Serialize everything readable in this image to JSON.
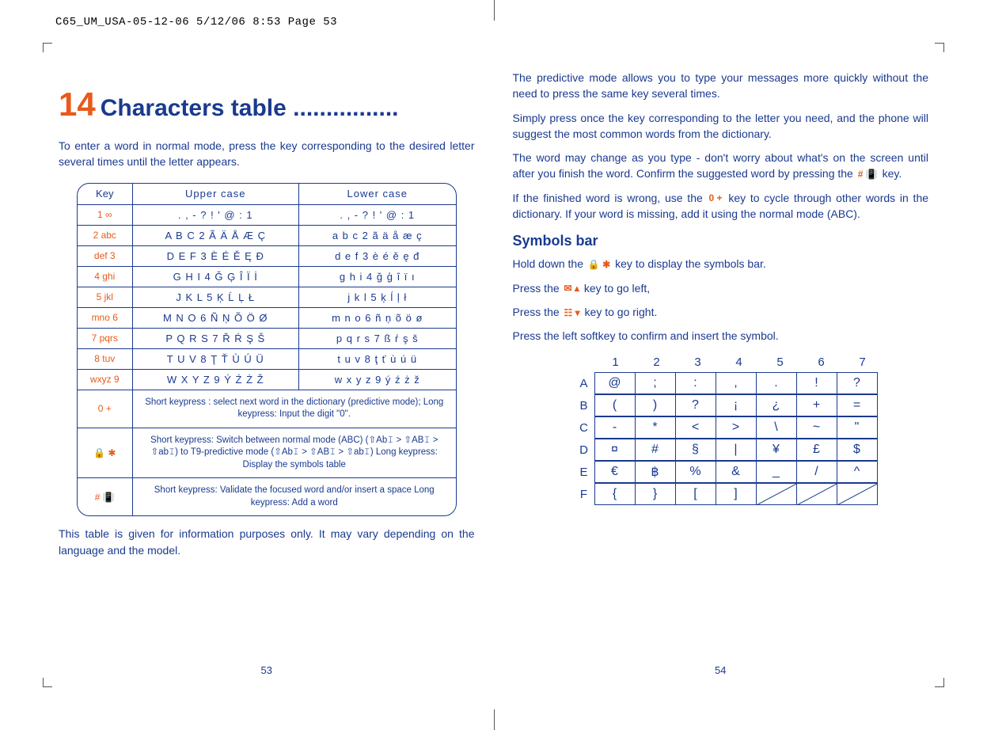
{
  "slug": "C65_UM_USA-05-12-06  5/12/06  8:53  Page 53",
  "left_page": {
    "chapter_number": "14",
    "chapter_title": "Characters table ................",
    "intro": "To enter a word in normal mode, press the key corresponding to the desired letter several times until the letter appears.",
    "table": {
      "headers": {
        "key": "Key",
        "upper": "Upper case",
        "lower": "Lower case"
      },
      "rows": [
        {
          "key": "1 ∞",
          "upper": ". , - ? ! ' @ : 1",
          "lower": ". , - ? ! ' @ : 1"
        },
        {
          "key": "2 abc",
          "upper": "A B C 2 Ã Ä Å Æ Ç",
          "lower": "a b c 2 ã ä å æ ç"
        },
        {
          "key": "def 3",
          "upper": "D E F 3 È É Ě Ę Đ",
          "lower": "d e f 3 è é ě ę đ"
        },
        {
          "key": "4 ghi",
          "upper": "G H I 4 Ğ Ģ Î Ï İ",
          "lower": "g h i 4 ğ ģ î ï ı"
        },
        {
          "key": "5 jkl",
          "upper": "J K L 5 Ķ Ĺ Ļ Ł",
          "lower": "j k l 5 ķ ĺ ļ ł"
        },
        {
          "key": "mno 6",
          "upper": "M N O 6 Ñ Ņ Õ Ö Ø",
          "lower": "m n o 6 ñ ņ õ ö ø"
        },
        {
          "key": "7 pqrs",
          "upper": "P Q R S 7 Ř Ŕ Ş Š",
          "lower": "p q r s 7 ß ŕ ş š"
        },
        {
          "key": "8 tuv",
          "upper": "T U V 8 Ţ Ť Ù Ú Ü",
          "lower": "t u v 8 ţ ť ù ú ü"
        },
        {
          "key": "wxyz 9",
          "upper": "W X Y Z 9 Ý Ź Ż Ž",
          "lower": "w x y z 9 ý ź ż ž"
        }
      ],
      "notes": [
        {
          "key": "0 +",
          "text": "Short keypress : select next word in the dictionary (predictive mode);\nLong keypress: Input the digit \"0\"."
        },
        {
          "key": "🔒 ✱",
          "text": "Short keypress: Switch between normal mode (ABC) (⇧Ab𝙸 > ⇧AB𝙸 > ⇧ab𝙸) to T9-predictive mode (⇧Ab𝙸 > ⇧AB𝙸 > ⇧ab𝙸)\nLong keypress: Display the symbols table"
        },
        {
          "key": "# 📳",
          "text": "Short keypress: Validate the focused word and/or insert a space\nLong keypress: Add a word"
        }
      ]
    },
    "footnote": "This table is given for information purposes only. It may vary depending on the language and the model.",
    "page_number": "53"
  },
  "right_page": {
    "paragraphs": [
      "The predictive mode allows you to type your messages more quickly without the need to press the same key several times.",
      "Simply press once the key corresponding to the letter you need, and the phone will suggest the most common words from the dictionary.",
      "The word may change as you type - don't worry about what's on the screen until after you finish the word. Confirm the suggested word by pressing the",
      "key."
    ],
    "para_cycle_a": "If the finished word is wrong, use the",
    "para_cycle_b": "key to cycle through other words in the dictionary. If your word is missing, add it using the normal mode (ABC).",
    "symbols_heading": "Symbols bar",
    "sym_line_a": "Hold down the",
    "sym_line_a2": "key to display the symbols bar.",
    "sym_line_b": "Press the",
    "sym_line_b2": "key to go left,",
    "sym_line_c": "Press the",
    "sym_line_c2": "key to go right.",
    "sym_line_d": "Press the left softkey to confirm and insert the symbol.",
    "grid": {
      "cols": [
        "1",
        "2",
        "3",
        "4",
        "5",
        "6",
        "7"
      ],
      "rows": [
        {
          "label": "A",
          "cells": [
            "@",
            ";",
            ":",
            ",",
            ".",
            "!",
            "?"
          ]
        },
        {
          "label": "B",
          "cells": [
            "(",
            ")",
            "?",
            "¡",
            "¿",
            "+",
            "="
          ]
        },
        {
          "label": "C",
          "cells": [
            "-",
            "*",
            "<",
            ">",
            "\\",
            "~",
            "\""
          ]
        },
        {
          "label": "D",
          "cells": [
            "¤",
            "#",
            "§",
            "|",
            "¥",
            "£",
            "$"
          ]
        },
        {
          "label": "E",
          "cells": [
            "€",
            "฿",
            "%",
            "&",
            "_",
            "/",
            "^"
          ]
        },
        {
          "label": "F",
          "cells": [
            "{",
            "}",
            "[",
            "]",
            "/",
            "/",
            "/"
          ]
        }
      ]
    },
    "page_number": "54",
    "key_glyphs": {
      "hash": "# 📳",
      "zero": "0 +",
      "lock": "🔒 ✱",
      "mail_up": "✉ ▴",
      "book_down": "☷ ▾"
    }
  }
}
